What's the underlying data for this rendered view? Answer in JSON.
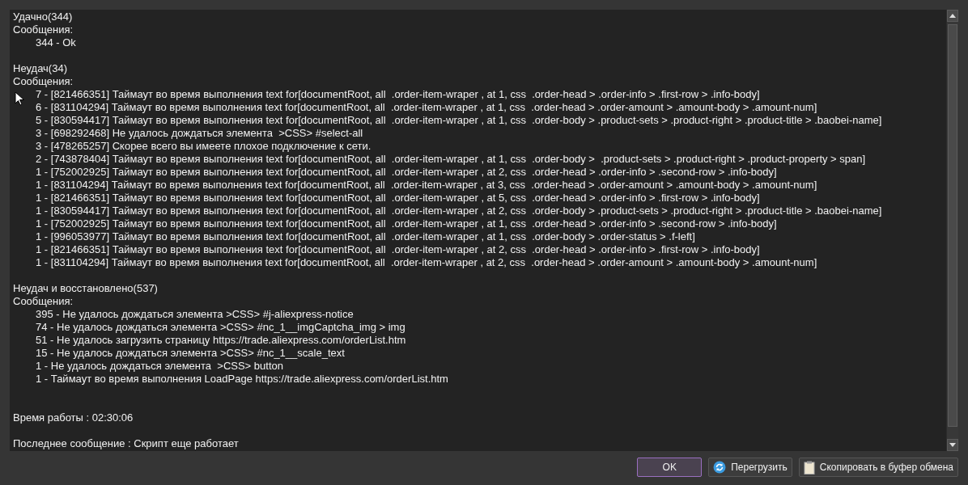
{
  "sections": [
    {
      "title": "Удачно(344)",
      "subtitle": "Сообщения:",
      "messages": [
        "344 - Ok"
      ]
    },
    {
      "title": "Неудач(34)",
      "subtitle": "Сообщения:",
      "messages": [
        "7 - [821466351] Таймаут во время выполнения text for[documentRoot, all  .order-item-wraper , at 1, css  .order-head > .order-info > .first-row > .info-body]",
        "6 - [831104294] Таймаут во время выполнения text for[documentRoot, all  .order-item-wraper , at 1, css  .order-head > .order-amount > .amount-body > .amount-num]",
        "5 - [830594417] Таймаут во время выполнения text for[documentRoot, all  .order-item-wraper , at 1, css  .order-body > .product-sets > .product-right > .product-title > .baobei-name]",
        "3 - [698292468] Не удалось дождаться элемента  >CSS> #select-all",
        "3 - [478265257] Скорее всего вы имеете плохое подключение к сети.",
        "2 - [743878404] Таймаут во время выполнения text for[documentRoot, all  .order-item-wraper , at 1, css  .order-body >  .product-sets > .product-right > .product-property > span]",
        "1 - [752002925] Таймаут во время выполнения text for[documentRoot, all  .order-item-wraper , at 2, css  .order-head > .order-info > .second-row > .info-body]",
        "1 - [831104294] Таймаут во время выполнения text for[documentRoot, all  .order-item-wraper , at 3, css  .order-head > .order-amount > .amount-body > .amount-num]",
        "1 - [821466351] Таймаут во время выполнения text for[documentRoot, all  .order-item-wraper , at 5, css  .order-head > .order-info > .first-row > .info-body]",
        "1 - [830594417] Таймаут во время выполнения text for[documentRoot, all  .order-item-wraper , at 2, css  .order-body > .product-sets > .product-right > .product-title > .baobei-name]",
        "1 - [752002925] Таймаут во время выполнения text for[documentRoot, all  .order-item-wraper , at 1, css  .order-head > .order-info > .second-row > .info-body]",
        "1 - [996053977] Таймаут во время выполнения text for[documentRoot, all  .order-item-wraper , at 1, css  .order-body > .order-status > .f-left]",
        "1 - [821466351] Таймаут во время выполнения text for[documentRoot, all  .order-item-wraper , at 2, css  .order-head > .order-info > .first-row > .info-body]",
        "1 - [831104294] Таймаут во время выполнения text for[documentRoot, all  .order-item-wraper , at 2, css  .order-head > .order-amount > .amount-body > .amount-num]"
      ]
    },
    {
      "title": "Неудач и восстановлено(537)",
      "subtitle": "Сообщения:",
      "messages": [
        "395 - Не удалось дождаться элемента >CSS> #j-aliexpress-notice",
        "74 - Не удалось дождаться элемента >CSS> #nc_1__imgCaptcha_img > img",
        "51 - Не удалось загрузить страницу https://trade.aliexpress.com/orderList.htm",
        "15 - Не удалось дождаться элемента >CSS> #nc_1__scale_text",
        "1 - Не удалось дождаться элемента  >CSS> button",
        "1 - Таймаут во время выполнения LoadPage https://trade.aliexpress.com/orderList.htm"
      ]
    }
  ],
  "run_time": "Время работы : 02:30:06",
  "last_message": "Последнее сообщение : Скрипт еще работает",
  "buttons": [
    {
      "label": "OK",
      "kind": "default"
    },
    {
      "label": "Перегрузить",
      "kind": "reload"
    },
    {
      "label": "Скопировать в буфер обмена",
      "kind": "copy"
    }
  ]
}
